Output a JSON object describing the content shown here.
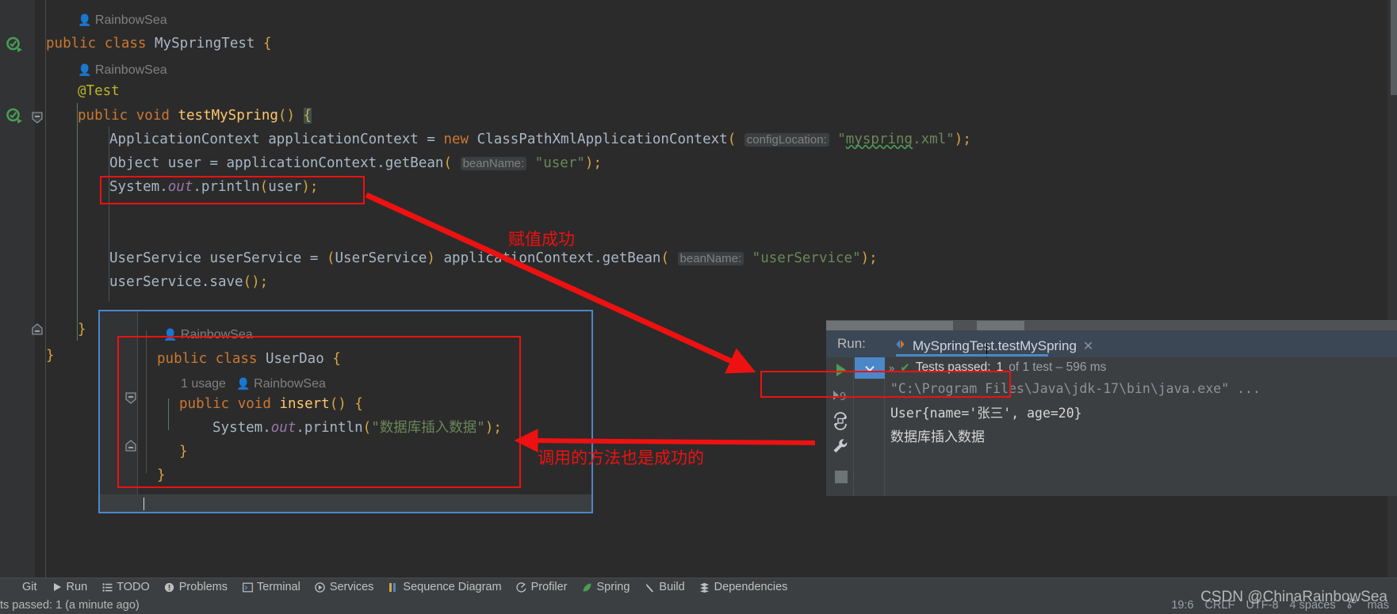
{
  "editor": {
    "lines": [
      {
        "indent": 1,
        "inlay": "RainbowSea",
        "type": "inlay"
      },
      {
        "type": "code",
        "text": "public class MySpringTest {"
      },
      {
        "indent": 2,
        "inlay": "RainbowSea",
        "type": "inlay"
      },
      {
        "type": "code",
        "text": "    @Test"
      },
      {
        "type": "code",
        "text": "    public void testMySpring() {"
      },
      {
        "type": "code",
        "text": "        ApplicationContext applicationContext = new ClassPathXmlApplicationContext( configLocation: \"myspring.xml\");"
      },
      {
        "type": "code",
        "text": "        Object user = applicationContext.getBean( beanName: \"user\");"
      },
      {
        "type": "code",
        "text": "        System.out.println(user);"
      },
      {
        "type": "code",
        "text": ""
      },
      {
        "type": "code",
        "text": ""
      },
      {
        "type": "code",
        "text": "        UserService userService = (UserService) applicationContext.getBean( beanName: \"userService\");"
      },
      {
        "type": "code",
        "text": "        userService.save();"
      },
      {
        "type": "code",
        "text": "    }"
      },
      {
        "type": "code",
        "text": "}"
      }
    ],
    "hints": {
      "config_location": "configLocation:",
      "bean_name": "beanName:"
    },
    "author_tag": "RainbowSea"
  },
  "dao_panel": {
    "author_tag": "RainbowSea",
    "usage_label": "1 usage",
    "lines": [
      "public class UserDao {",
      "    public void insert() {",
      "        System.out.println(\"数据库插入数据\");",
      "    }",
      "}"
    ],
    "print_string": "数据库插入数据"
  },
  "annotations": [
    {
      "id": "annot-assign-ok",
      "text": "赋值成功"
    },
    {
      "id": "annot-method-ok",
      "text": "调用的方法也是成功的"
    }
  ],
  "run_window": {
    "run_label": "Run:",
    "tab_title": "MySpringTest.testMySpring",
    "close_glyph": "✕",
    "tests_chevron": "»",
    "tests_check": "✔",
    "tests_label": "Tests passed:",
    "tests_count": "1",
    "tests_suffix": "of 1 test – 596 ms",
    "console": {
      "command_line": "\"C:\\Program Files\\Java\\jdk-17\\bin\\java.exe\" ...",
      "output_line_1": "User{name='张三', age=20}",
      "output_line_2": "数据库插入数据"
    },
    "side_buttons": [
      {
        "name": "rerun-button",
        "glyph": "▶"
      },
      {
        "name": "toggle-output-button",
        "glyph": "9"
      },
      {
        "name": "rerun-failed-button",
        "glyph": "⟳"
      },
      {
        "name": "settings-wrench-button",
        "glyph": "🔧"
      },
      {
        "name": "stop-button",
        "glyph": "■"
      }
    ]
  },
  "toolbar": {
    "items": [
      {
        "label": "Git",
        "icon": "git-icon"
      },
      {
        "label": "Run",
        "icon": "run-icon"
      },
      {
        "label": "TODO",
        "icon": "todo-icon"
      },
      {
        "label": "Problems",
        "icon": "problems-icon"
      },
      {
        "label": "Terminal",
        "icon": "terminal-icon"
      },
      {
        "label": "Services",
        "icon": "services-icon"
      },
      {
        "label": "Sequence Diagram",
        "icon": "sequence-diagram-icon"
      },
      {
        "label": "Profiler",
        "icon": "profiler-icon"
      },
      {
        "label": "Spring",
        "icon": "spring-icon"
      },
      {
        "label": "Build",
        "icon": "build-icon"
      },
      {
        "label": "Dependencies",
        "icon": "dependencies-icon"
      }
    ]
  },
  "statusbar": {
    "message": "ts passed: 1 (a minute ago)",
    "caret_position": "19:6",
    "line_separator": "CRLF",
    "encoding": "UTF-8",
    "indent": "4 spaces",
    "branch": "mas"
  },
  "watermark": {
    "text": "CSDN @ChinaRainbowSea"
  },
  "colors": {
    "background": "#2b2b2b",
    "panel": "#3c3f41",
    "accent_red": "#ee1111",
    "accent_blue": "#4a88c7",
    "green": "#499c54",
    "keyword_orange": "#cc7832",
    "string_green": "#6a8759",
    "method_yellow": "#ffc66d"
  }
}
